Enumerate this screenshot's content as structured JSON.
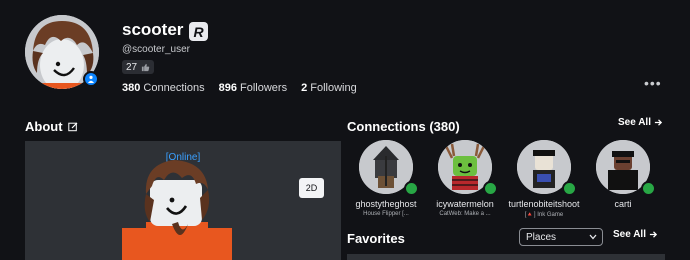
{
  "profile": {
    "display_name": "scooter",
    "handle": "@scooter_user",
    "likes": "27",
    "connections_label": "Connections",
    "connections_count": "380",
    "followers_label": "Followers",
    "followers_count": "896",
    "following_label": "Following",
    "following_count": "2",
    "badge_letter": "R",
    "more": "•••"
  },
  "about": {
    "title": "About",
    "status": "[Online]",
    "view_toggle": "2D"
  },
  "connections": {
    "title": "Connections (380)",
    "see_all": "See All",
    "friends": [
      {
        "name": "ghostytheghost",
        "status": "House Flipper [..."
      },
      {
        "name": "icywatermelon",
        "status": "CatWeb: Make a ..."
      },
      {
        "name": "turtlenobiteitshoot",
        "status": "[🔺] Ink Game"
      },
      {
        "name": "carti",
        "status": ""
      }
    ]
  },
  "favorites": {
    "title": "Favorites",
    "see_all": "See All",
    "filter_value": "Places"
  },
  "colors": {
    "background": "#111216",
    "panel": "#2e3136",
    "online_blue": "#3aa0ff",
    "presence_green": "#28a745",
    "verified_blue": "#0b84ff"
  }
}
